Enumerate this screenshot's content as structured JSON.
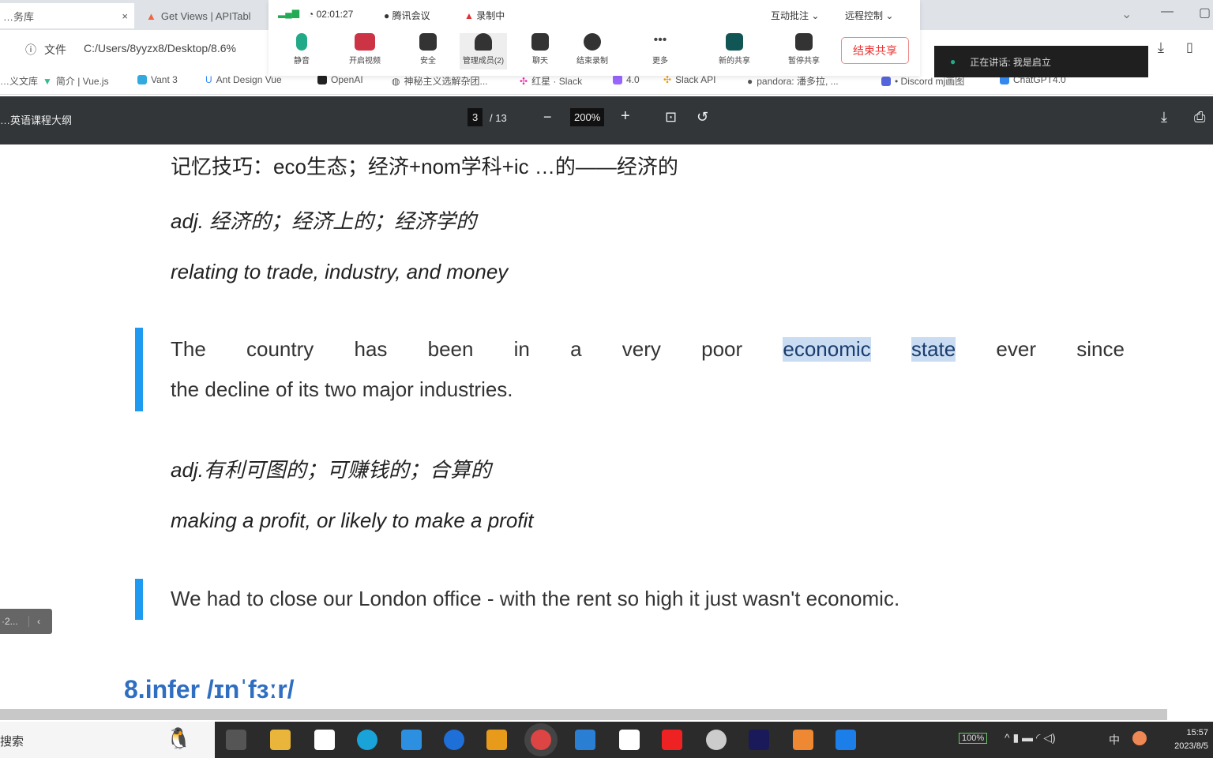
{
  "browser": {
    "tabs": [
      {
        "label": "…务库",
        "close": "×"
      },
      {
        "label": "Get Views | APITabl"
      }
    ],
    "address": {
      "scheme_label": "文件",
      "url": "C:/Users/8yyzx8/Desktop/8.6%"
    },
    "bookmarks": [
      "…义文库",
      "简介 | Vue.js",
      "Vant 3",
      "Ant Design Vue",
      "OpenAI",
      "神秘主义选解杂团...",
      "红星 · Slack",
      "4.0",
      "Slack API",
      "pandora: 潘多拉, ...",
      "• Discord mj画图",
      "ChatGPT4.0"
    ]
  },
  "meeting": {
    "timer": "02:01:27",
    "app": "腾讯会议",
    "recording": "录制中",
    "top_menus": [
      "互动批注",
      "远程控制"
    ],
    "buttons": [
      {
        "label": "静音",
        "icon": "mic-icon"
      },
      {
        "label": "开启视频",
        "icon": "video-off-icon"
      },
      {
        "label": "安全",
        "icon": "shield-icon"
      },
      {
        "label": "管理成员(2)",
        "icon": "person-icon"
      },
      {
        "label": "聊天",
        "icon": "chat-icon"
      },
      {
        "label": "结束录制",
        "icon": "stop-record-icon"
      },
      {
        "label": "更多",
        "icon": "more-icon"
      },
      {
        "label": "新的共享",
        "icon": "share-icon"
      },
      {
        "label": "暂停共享",
        "icon": "pause-icon"
      }
    ],
    "end_share": "结束共享",
    "speaking": "正在讲话: 我是启立"
  },
  "pdf": {
    "title": "…英语课程大纲",
    "page_current": "3",
    "page_total": "/ 13",
    "zoom": "200%"
  },
  "content": {
    "memory_tip": "记忆技巧：eco生态；经济+nom学科+ic …的——经济的",
    "def1_cn": "adj. 经济的；经济上的；经济学的",
    "def1_en": "relating to trade, industry, and money",
    "example1_words": [
      "The",
      "country",
      "has",
      "been",
      "in",
      "a",
      "very",
      "poor",
      "economic",
      "state",
      "ever",
      "since"
    ],
    "example1_line2": "the decline of its two major industries.",
    "def2_cn": "adj.有利可图的；可赚钱的；合算的",
    "def2_en": "making a profit, or likely to make a profit",
    "example2": "We had to close our London office - with the rent so high it just wasn't economic.",
    "next_heading": "8.infer /ɪnˈfɜːr/"
  },
  "side_tab": "·2...",
  "taskbar": {
    "search": "搜索",
    "battery": "100%",
    "ime": "中",
    "time": "15:57",
    "date": "2023/8/5"
  },
  "colors": {
    "quote_bar": "#1e9bf0",
    "heading": "#2f6ec0",
    "highlight": "#c9dcf2",
    "end_share": "#e33333"
  }
}
